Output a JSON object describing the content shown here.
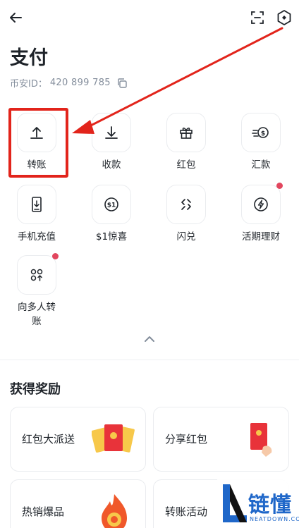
{
  "colors": {
    "accent_red": "#e2241b",
    "notification_dot": "#e2465e",
    "text_primary": "#1e2329",
    "text_secondary": "#848e9c",
    "watermark_blue": "#1f67c9"
  },
  "header": {
    "back_icon": "arrow-left-icon",
    "scan_icon": "scan-icon",
    "settings_icon": "settings-hexagon-icon"
  },
  "page": {
    "title": "支付",
    "uid_label": "币安ID：",
    "uid_value": "420 899 785",
    "copy_icon": "copy-icon"
  },
  "actions": [
    {
      "label": "转账",
      "icon": "upload-arrow-icon",
      "badge": false,
      "highlighted": true
    },
    {
      "label": "收款",
      "icon": "download-arrow-icon",
      "badge": false
    },
    {
      "label": "红包",
      "icon": "gift-icon",
      "badge": false
    },
    {
      "label": "汇款",
      "icon": "remittance-icon",
      "badge": false
    },
    {
      "label": "手机充值",
      "icon": "mobile-topup-icon",
      "badge": false
    },
    {
      "label": "$1惊喜",
      "icon": "dollar-coin-icon",
      "badge": false
    },
    {
      "label": "闪兑",
      "icon": "swap-icon",
      "badge": false
    },
    {
      "label": "活期理财",
      "icon": "lightning-earn-icon",
      "badge": true
    },
    {
      "label": "向多人转\n账",
      "icon": "multi-transfer-icon",
      "badge": true
    }
  ],
  "collapse_icon": "chevron-up-icon",
  "rewards": {
    "title": "获得奖励",
    "cards": [
      {
        "label": "红包大派送",
        "art": "red-envelopes-illustration"
      },
      {
        "label": "分享红包",
        "art": "share-red-envelope-illustration"
      },
      {
        "label": "热销爆品",
        "art": "flame-illustration"
      },
      {
        "label": "转账活动",
        "art": "transfer-promo-illustration"
      }
    ]
  },
  "watermark": {
    "text": "链懂",
    "sub": "NEATDOWN.COM"
  }
}
